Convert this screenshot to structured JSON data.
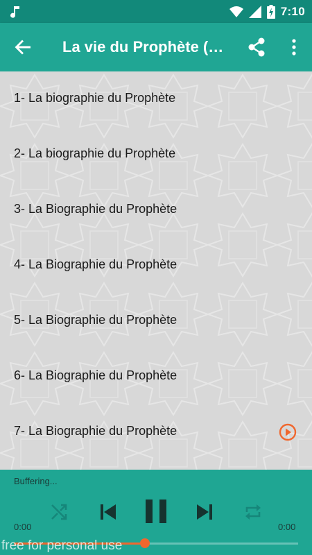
{
  "status_bar": {
    "time": "7:10",
    "icons": [
      "music-note-icon",
      "wifi-icon",
      "signal-icon",
      "battery-charging-icon"
    ]
  },
  "app_bar": {
    "title": "La vie du Prophète (…",
    "icons": [
      "back-arrow-icon",
      "share-icon",
      "more-vert-icon"
    ]
  },
  "list": {
    "items": [
      {
        "label": "1- La biographie du Prophète",
        "playing": false
      },
      {
        "label": "2- La biographie du Prophète",
        "playing": false
      },
      {
        "label": "3- La Biographie du Prophète",
        "playing": false
      },
      {
        "label": "4- La Biographie du Prophète",
        "playing": false
      },
      {
        "label": "5- La Biographie du Prophète",
        "playing": false
      },
      {
        "label": "6- La Biographie du Prophète",
        "playing": false
      },
      {
        "label": "7- La Biographie du Prophète",
        "playing": true
      }
    ]
  },
  "player": {
    "status": "Buffering...",
    "current_time": "0:00",
    "total_time": "0:00",
    "progress_fraction": 0.46,
    "controls": [
      "shuffle-icon",
      "skip-previous-icon",
      "pause-icon",
      "skip-next-icon",
      "repeat-icon"
    ]
  },
  "watermark": "free for personal use",
  "colors": {
    "status_bar": "#12897a",
    "app_bar": "#20a694",
    "player": "#1fa693",
    "accent": "#f0672e",
    "list_background": "#d8d8d8"
  }
}
